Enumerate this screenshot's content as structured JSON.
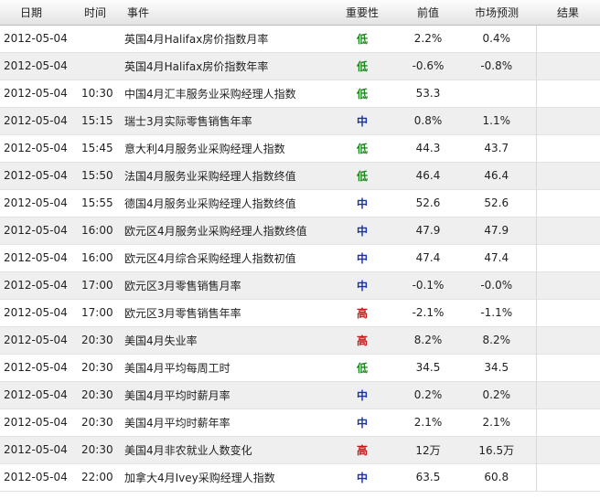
{
  "colors": {
    "low": "#1a8a1a",
    "medium": "#1a2fbf",
    "high": "#c81414"
  },
  "headers": {
    "date": "日期",
    "time": "时间",
    "event": "事件",
    "importance": "重要性",
    "previous": "前值",
    "forecast": "市场预测",
    "result": "结果"
  },
  "rows": [
    {
      "date": "2012-05-04",
      "time": "",
      "event": "英国4月Halifax房价指数月率",
      "importance": "低",
      "level": "low",
      "previous": "2.2%",
      "forecast": "0.4%",
      "result": ""
    },
    {
      "date": "2012-05-04",
      "time": "",
      "event": "英国4月Halifax房价指数年率",
      "importance": "低",
      "level": "low",
      "previous": "-0.6%",
      "forecast": "-0.8%",
      "result": ""
    },
    {
      "date": "2012-05-04",
      "time": "10:30",
      "event": "中国4月汇丰服务业采购经理人指数",
      "importance": "低",
      "level": "low",
      "previous": "53.3",
      "forecast": "",
      "result": ""
    },
    {
      "date": "2012-05-04",
      "time": "15:15",
      "event": "瑞士3月实际零售销售年率",
      "importance": "中",
      "level": "medium",
      "previous": "0.8%",
      "forecast": "1.1%",
      "result": ""
    },
    {
      "date": "2012-05-04",
      "time": "15:45",
      "event": "意大利4月服务业采购经理人指数",
      "importance": "低",
      "level": "low",
      "previous": "44.3",
      "forecast": "43.7",
      "result": ""
    },
    {
      "date": "2012-05-04",
      "time": "15:50",
      "event": "法国4月服务业采购经理人指数终值",
      "importance": "低",
      "level": "low",
      "previous": "46.4",
      "forecast": "46.4",
      "result": ""
    },
    {
      "date": "2012-05-04",
      "time": "15:55",
      "event": "德国4月服务业采购经理人指数终值",
      "importance": "中",
      "level": "medium",
      "previous": "52.6",
      "forecast": "52.6",
      "result": ""
    },
    {
      "date": "2012-05-04",
      "time": "16:00",
      "event": "欧元区4月服务业采购经理人指数终值",
      "importance": "中",
      "level": "medium",
      "previous": "47.9",
      "forecast": "47.9",
      "result": ""
    },
    {
      "date": "2012-05-04",
      "time": "16:00",
      "event": "欧元区4月综合采购经理人指数初值",
      "importance": "中",
      "level": "medium",
      "previous": "47.4",
      "forecast": "47.4",
      "result": ""
    },
    {
      "date": "2012-05-04",
      "time": "17:00",
      "event": "欧元区3月零售销售月率",
      "importance": "中",
      "level": "medium",
      "previous": "-0.1%",
      "forecast": "-0.0%",
      "result": ""
    },
    {
      "date": "2012-05-04",
      "time": "17:00",
      "event": "欧元区3月零售销售年率",
      "importance": "高",
      "level": "high",
      "previous": "-2.1%",
      "forecast": "-1.1%",
      "result": ""
    },
    {
      "date": "2012-05-04",
      "time": "20:30",
      "event": "美国4月失业率",
      "importance": "高",
      "level": "high",
      "previous": "8.2%",
      "forecast": "8.2%",
      "result": ""
    },
    {
      "date": "2012-05-04",
      "time": "20:30",
      "event": "美国4月平均每周工时",
      "importance": "低",
      "level": "low",
      "previous": "34.5",
      "forecast": "34.5",
      "result": ""
    },
    {
      "date": "2012-05-04",
      "time": "20:30",
      "event": "美国4月平均时薪月率",
      "importance": "中",
      "level": "medium",
      "previous": "0.2%",
      "forecast": "0.2%",
      "result": ""
    },
    {
      "date": "2012-05-04",
      "time": "20:30",
      "event": "美国4月平均时薪年率",
      "importance": "中",
      "level": "medium",
      "previous": "2.1%",
      "forecast": "2.1%",
      "result": ""
    },
    {
      "date": "2012-05-04",
      "time": "20:30",
      "event": "美国4月非农就业人数变化",
      "importance": "高",
      "level": "high",
      "previous": "12万",
      "forecast": "16.5万",
      "result": ""
    },
    {
      "date": "2012-05-04",
      "time": "22:00",
      "event": "加拿大4月Ivey采购经理人指数",
      "importance": "中",
      "level": "medium",
      "previous": "63.5",
      "forecast": "60.8",
      "result": ""
    }
  ]
}
